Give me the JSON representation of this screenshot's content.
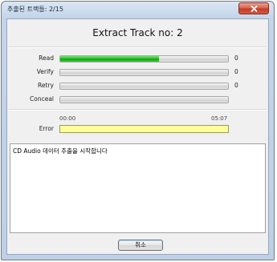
{
  "window": {
    "title": "추출된 트랙들: 2/15"
  },
  "icons": {
    "close": "close-x-icon"
  },
  "main": {
    "heading": "Extract Track no: 2",
    "rows": [
      {
        "label": "Read",
        "count": "0",
        "progress": 0.59
      },
      {
        "label": "Verify",
        "count": "0",
        "progress": 0
      },
      {
        "label": "Retry",
        "count": "0",
        "progress": 0
      },
      {
        "label": "Conceal",
        "count": "",
        "progress": 0
      }
    ],
    "timeline": {
      "start": "00:00",
      "end": "05:07"
    },
    "error_label": "Error",
    "log_lines": [
      "CD Audio 데이터 추출을 시작합니다"
    ]
  },
  "buttons": {
    "cancel": "취소"
  },
  "colors": {
    "progress_green": "#10a510",
    "error_bar": "#ffff99",
    "close_red": "#c43c25"
  }
}
